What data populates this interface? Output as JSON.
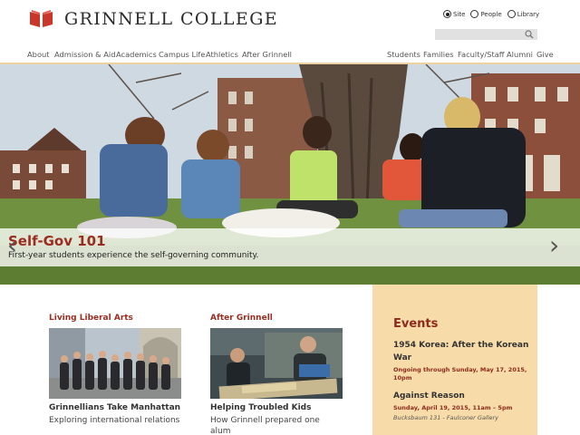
{
  "header": {
    "logo_text": "GRINNELL COLLEGE",
    "scope_options": [
      {
        "label": "Site",
        "selected": true
      },
      {
        "label": "People",
        "selected": false
      },
      {
        "label": "Library",
        "selected": false
      }
    ],
    "search": {
      "value": "",
      "placeholder": ""
    }
  },
  "nav": {
    "left": [
      "About",
      "Admission & Aid",
      "Academics",
      "Campus Life",
      "Athletics",
      "After Grinnell"
    ],
    "right": [
      "Students",
      "Families",
      "Faculty/Staff",
      "Alumni",
      "Give"
    ]
  },
  "hero": {
    "title": "Self-Gov 101",
    "subtitle": "First-year students experience the self-governing community.",
    "prev_icon": "chevron-left-icon",
    "next_icon": "chevron-right-icon"
  },
  "features": [
    {
      "heading": "Living Liberal Arts",
      "title": "Grinnellians Take Manhattan",
      "text": "Exploring international relations"
    },
    {
      "heading": "After Grinnell",
      "title": "Helping Troubled Kids",
      "text": "How Grinnell prepared one alum"
    }
  ],
  "events": {
    "heading": "Events",
    "items": [
      {
        "title": "1954 Korea: After the Korean War",
        "date": "Ongoing through Sunday, May 17, 2015, 10pm",
        "location": ""
      },
      {
        "title": "Against Reason",
        "date": "Sunday, April 19, 2015, 11am – 5pm",
        "location": "Bucksbaum 131 - Faulconer Gallery"
      }
    ]
  },
  "colors": {
    "brand_red": "#9b2d20",
    "events_bg": "#f7dca9",
    "nav_rule": "#ecd2a1"
  }
}
